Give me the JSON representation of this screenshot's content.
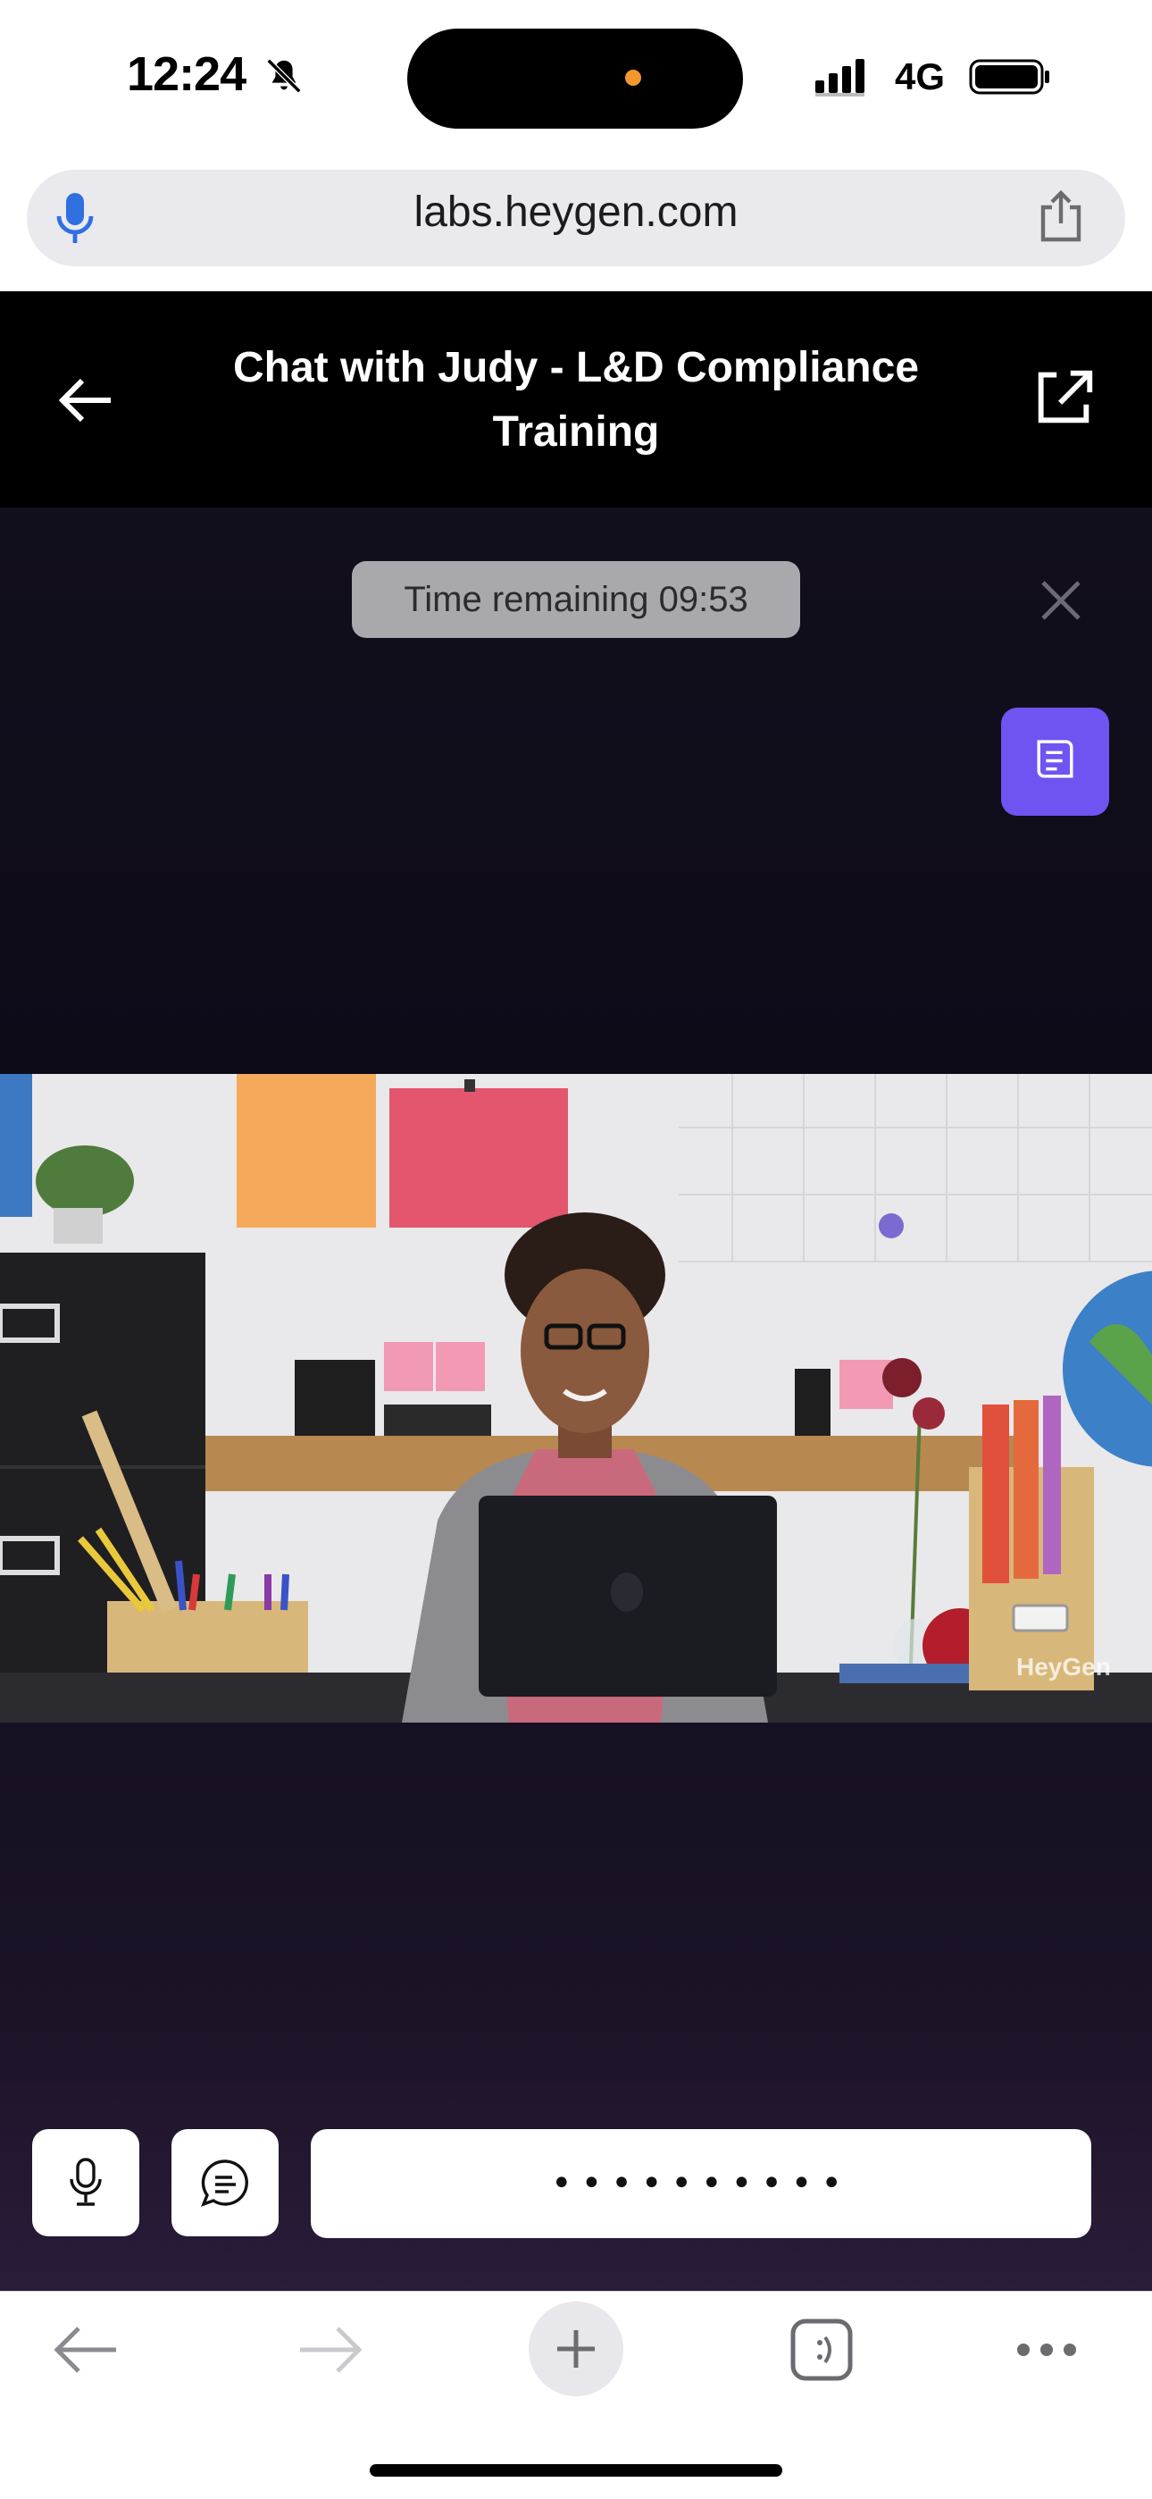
{
  "status_bar": {
    "time": "12:24",
    "network": "4G"
  },
  "browser": {
    "url": "labs.heygen.com"
  },
  "header": {
    "title": "Chat with Judy - L&D Compliance Training"
  },
  "session": {
    "timer_label": "Time remaining 09:53"
  },
  "video": {
    "watermark": "HeyGen"
  },
  "input": {
    "value": "••••••••••"
  },
  "colors": {
    "accent": "#6f54f2",
    "header_bg": "#000000",
    "main_bg_top": "#120f1d",
    "main_bg_bottom": "#2a1c3a"
  }
}
